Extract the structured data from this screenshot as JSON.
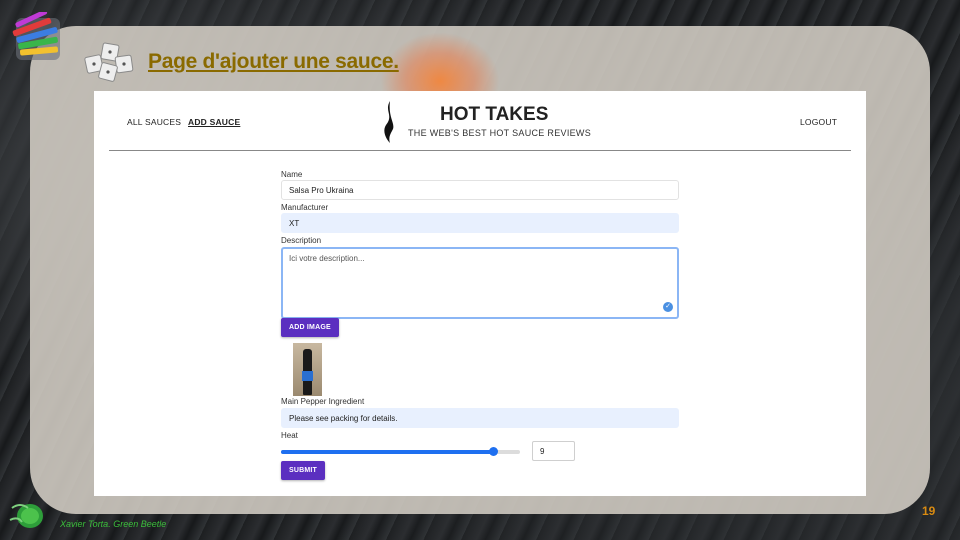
{
  "slide": {
    "title": "Page d'ajouter une sauce.",
    "author": "Xavier Torta. Green Beetle",
    "page_number": "19"
  },
  "nav": {
    "all_sauces": "ALL SAUCES",
    "add_sauce": "ADD SAUCE",
    "logout": "LOGOUT"
  },
  "brand": {
    "title": "HOT TAKES",
    "subtitle": "THE WEB'S BEST HOT SAUCE REVIEWS"
  },
  "form": {
    "name": {
      "label": "Name",
      "value": "Salsa Pro Ukraina"
    },
    "manufacturer": {
      "label": "Manufacturer",
      "value": "XT"
    },
    "description": {
      "label": "Description",
      "placeholder": "Ici votre description..."
    },
    "add_image_label": "ADD IMAGE",
    "main_pepper": {
      "label": "Main Pepper Ingredient",
      "value": "Please see packing for details."
    },
    "heat": {
      "label": "Heat",
      "value": "9",
      "min": 1,
      "max": 10
    },
    "submit_label": "SUBMIT"
  },
  "colors": {
    "accent_button": "#5b2fc0",
    "slider": "#1e6ff0",
    "title": "#8a6a00",
    "author": "#3bbf3b",
    "page_number": "#d98b12"
  },
  "icons": {
    "header_left": "pencils-logo",
    "title_icon": "cubes-icon",
    "brand": "flame-icon",
    "footer": "green-beetle-logo",
    "textarea_status": "check-circle-icon"
  }
}
